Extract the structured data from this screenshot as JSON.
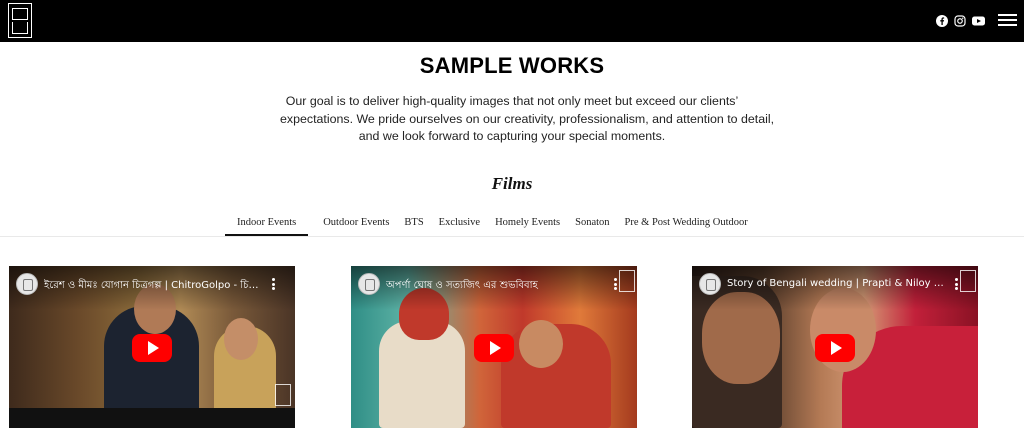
{
  "header": {
    "social": [
      "facebook-icon",
      "instagram-icon",
      "youtube-icon"
    ],
    "menu_icon": "hamburger-menu-icon"
  },
  "main": {
    "title": "SAMPLE WORKS",
    "intro_lines": [
      "Our goal is to deliver high-quality images that not only meet but exceed our clients’",
      "expectations. We pride ourselves on our creativity, professionalism, and attention to detail,",
      "and we look forward to capturing your special moments."
    ],
    "section_title": "Films",
    "tabs": [
      {
        "label": "Indoor Events",
        "active": true
      },
      {
        "label": "Outdoor Events",
        "active": false
      },
      {
        "label": "BTS",
        "active": false
      },
      {
        "label": "Exclusive",
        "active": false
      },
      {
        "label": "Homely Events",
        "active": false
      },
      {
        "label": "Sonaton",
        "active": false
      },
      {
        "label": "Pre & Post Wedding Outdoor",
        "active": false
      }
    ],
    "videos": [
      {
        "title": "ইরেশ ও মীমঃ যোগান চিত্রগল্প | ChitroGolpo - চিত্রগল্প"
      },
      {
        "title": "অপর্ণা ঘোষ ও সত্যজিৎ এর শুভবিবাহ"
      },
      {
        "title": "Story of Bengali wedding | Prapti & Niloy | Chit..."
      }
    ]
  },
  "colors": {
    "topbar": "#000000",
    "play_button": "#ff0000",
    "text": "#222222"
  }
}
